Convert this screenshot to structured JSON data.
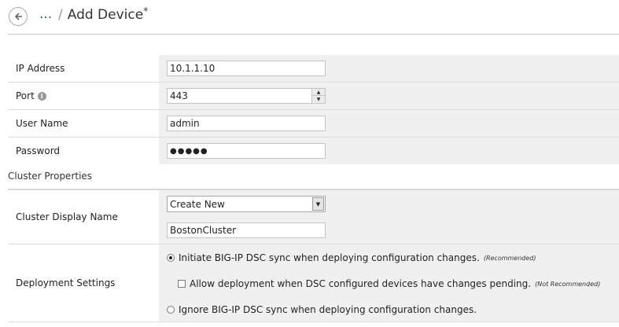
{
  "header": {
    "back_icon": "arrow-left-icon",
    "breadcrumb": "...",
    "separator": "/",
    "title": "Add Device",
    "modified_marker": "*"
  },
  "form": {
    "ip_label": "IP Address",
    "ip_value": "10.1.1.10",
    "port_label": "Port",
    "port_info_icon": "info-icon",
    "port_value": "443",
    "username_label": "User Name",
    "username_value": "admin",
    "password_label": "Password",
    "password_value": "●●●●●"
  },
  "cluster": {
    "section_title": "Cluster Properties",
    "display_name_label": "Cluster Display Name",
    "select_value": "Create New",
    "name_value": "BostonCluster"
  },
  "deployment": {
    "label": "Deployment Settings",
    "option1": "Initiate BIG-IP DSC sync when deploying configuration changes.",
    "option1_note": "(Recommended)",
    "option1_selected": true,
    "suboption": "Allow deployment when DSC configured devices have changes pending.",
    "suboption_note": "(Not Recommended)",
    "suboption_checked": false,
    "option2": "Ignore BIG-IP DSC sync when deploying configuration changes.",
    "option2_selected": false
  }
}
